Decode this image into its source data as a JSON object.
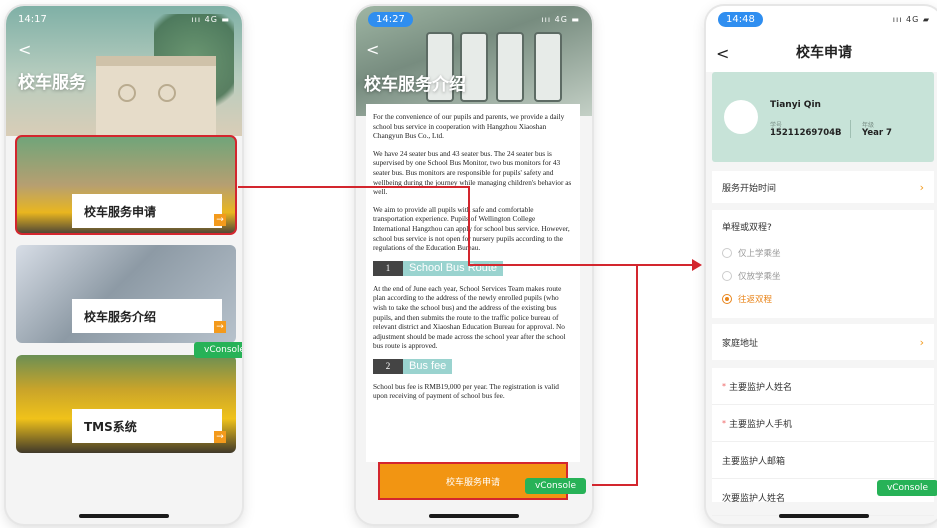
{
  "phone1": {
    "time": "14:17",
    "status_icons": "ııı 4G ▬",
    "back": "<",
    "title": "校车服务",
    "cards": [
      {
        "label": "校车服务申请"
      },
      {
        "label": "校车服务介绍"
      },
      {
        "label": "TMS系统"
      }
    ],
    "card_go_glyph": "→",
    "vconsole": "vConsole"
  },
  "phone2": {
    "time": "14:27",
    "status_icons": "ııı 4G ▬",
    "back": "<",
    "title": "校车服务介绍",
    "paragraphs": [
      "For the convenience of our pupils and parents, we provide a daily school bus service in cooperation with Hangzhou Xiaoshan Changyun Bus Co., Ltd.",
      "We have 24 seater bus and 43 seater bus. The 24 seater bus is supervised by one School Bus Monitor, two bus monitors for 43 seater bus. Bus monitors are responsible for pupils' safety and wellbeing during the journey while managing children's behavior as well.",
      "We aim to provide all pupils with safe and comfortable transportation experience. Pupils of Wellington College International Hangzhou can apply for school bus service. However, school bus service is not open for nursery pupils according to the regulations of the Education Bureau."
    ],
    "section1": {
      "num": "1",
      "title": "School Bus Route",
      "body": "At the end of June each year, School Services Team makes route plan according to the address of the newly enrolled pupils (who wish to take the school bus) and the address of the existing bus pupils, and then submits the route to the traffic police bureau of relevant district and Xiaoshan Education Bureau for approval. No adjustment should be made across the school year after the school bus route is approved."
    },
    "section2": {
      "num": "2",
      "title": "Bus fee",
      "body": "School bus fee is RMB19,000 per year. The registration is valid upon receiving of payment of school bus fee."
    },
    "apply_button": "校车服务申请",
    "vconsole": "vConsole"
  },
  "phone3": {
    "time": "14:48",
    "status_icons": "ııı 4G ▰",
    "back": "<",
    "title": "校车申请",
    "student": {
      "name": "Tianyi Qin",
      "id_label": "学号",
      "id": "15211269704B",
      "grade_label": "年级",
      "grade": "Year 7"
    },
    "service_start": "服务开始时间",
    "trip_question": "单程或双程?",
    "trip_options": [
      "仅上学乘坐",
      "仅放学乘坐",
      "往返双程"
    ],
    "address": "家庭地址",
    "fields": [
      "主要监护人姓名",
      "主要监护人手机",
      "主要监护人邮箱",
      "次要监护人姓名"
    ],
    "chevron": "›",
    "vconsole": "vConsole"
  },
  "colors": {
    "accent_orange": "#f29512",
    "highlight_red": "#d3262e",
    "vconsole_green": "#27b257",
    "profile_green": "#c7e3d8"
  }
}
